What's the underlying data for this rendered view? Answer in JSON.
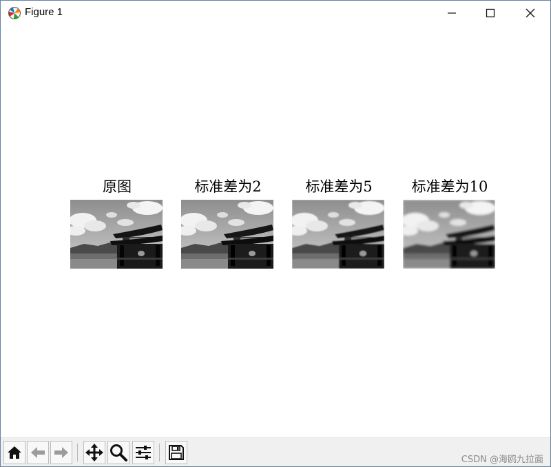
{
  "window": {
    "title": "Figure 1",
    "icons": [
      "matplotlib-icon",
      "minimize-icon",
      "maximize-icon",
      "close-icon"
    ]
  },
  "figure": {
    "subplots": [
      {
        "title": "原图"
      },
      {
        "title": "标准差为2"
      },
      {
        "title": "标准差为5"
      },
      {
        "title": "标准差为10"
      }
    ]
  },
  "toolbar": {
    "buttons": [
      "home-icon",
      "back-icon",
      "forward-icon",
      "pan-icon",
      "zoom-icon",
      "configure-subplots-icon",
      "save-icon"
    ]
  },
  "watermark": "CSDN @海鸥九拉面"
}
